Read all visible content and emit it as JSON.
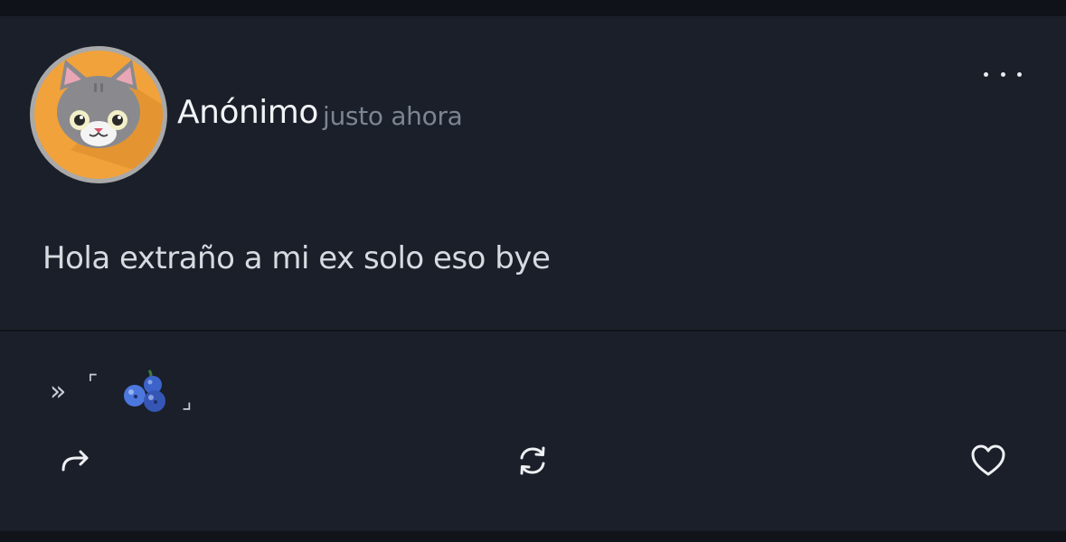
{
  "post": {
    "author": "Anónimo",
    "timestamp": "justo ahora",
    "body": "Hola extraño a mi ex solo eso bye",
    "tag": {
      "prefix": "»",
      "open_bracket": "⌜",
      "close_bracket": "⌟",
      "emoji_icon": "blueberries-icon"
    }
  },
  "avatar": {
    "icon": "cat-face-icon",
    "background_color": "#f2a23a",
    "ring_color": "#a9a9a9"
  },
  "actions": {
    "more_icon": "more-horizontal-icon",
    "share_icon": "share-arrow-icon",
    "repost_icon": "repost-icon",
    "like_icon": "heart-icon"
  },
  "colors": {
    "background": "#10141a",
    "card": "#1a1f29",
    "text_primary": "#f1f3f6",
    "text_secondary": "#7c8593"
  }
}
